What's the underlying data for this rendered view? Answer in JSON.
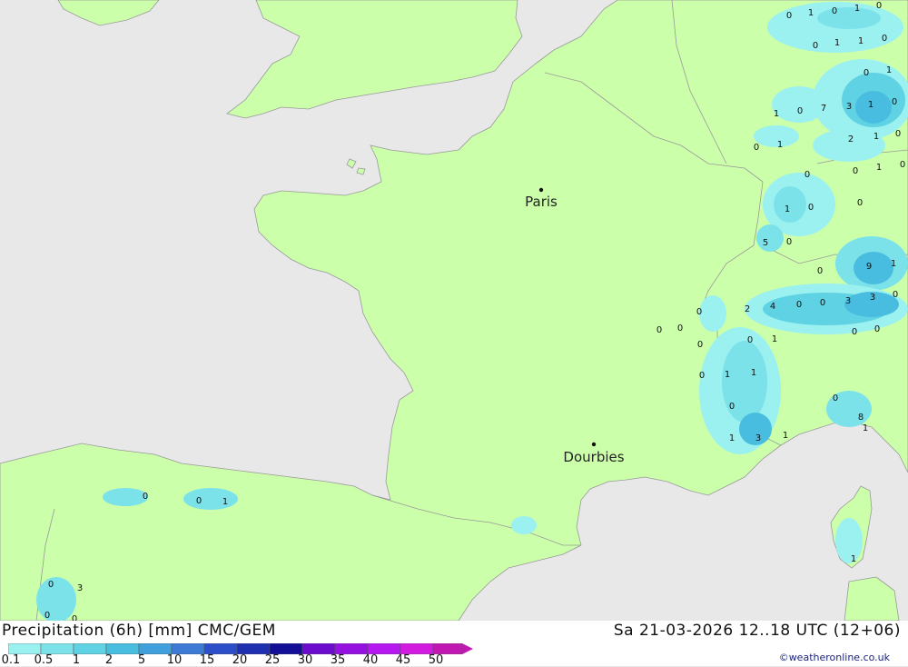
{
  "title": "Precipitation (6h) [mm] CMC/GEM",
  "datetime": "Sa 21-03-2026 12..18 UTC (12+06)",
  "credit": "©weatheronline.co.uk",
  "colors": {
    "sea": "#e8e8e8",
    "land": "#ccffaa",
    "border": "#999999",
    "scale": [
      "#9bf0f0",
      "#7be2ea",
      "#5fd2e4",
      "#48bde0",
      "#3fa0dc",
      "#3c7ad6",
      "#2c4ec8",
      "#1e2fb0",
      "#120e96",
      "#6b0ccc",
      "#9412e0",
      "#b418ee",
      "#d21ce0",
      "#c018b0"
    ]
  },
  "cities": [
    {
      "name": "Paris"
    },
    {
      "name": "Dourbies"
    }
  ],
  "legend": {
    "ticks": [
      "0.1",
      "0.5",
      "1",
      "2",
      "5",
      "10",
      "15",
      "20",
      "25",
      "30",
      "35",
      "40",
      "45",
      "50"
    ]
  },
  "values": [
    "0",
    "1",
    "0",
    "1",
    "0",
    "0",
    "1",
    "1",
    "0",
    "0",
    "1",
    "1",
    "0",
    "7",
    "3",
    "1",
    "0",
    "0",
    "1",
    "2",
    "1",
    "0",
    "0",
    "1",
    "0",
    "0",
    "0",
    "1",
    "0",
    "0",
    "5",
    "0",
    "0",
    "9",
    "1",
    "0",
    "0",
    "3",
    "3",
    "2",
    "4",
    "0",
    "0",
    "0",
    "0",
    "0",
    "0",
    "0",
    "1",
    "0",
    "1",
    "1",
    "0",
    "1",
    "3",
    "1",
    "0",
    "8",
    "1",
    "0",
    "0",
    "1",
    "0",
    "3",
    "0",
    "0",
    "1",
    "0",
    "0"
  ]
}
